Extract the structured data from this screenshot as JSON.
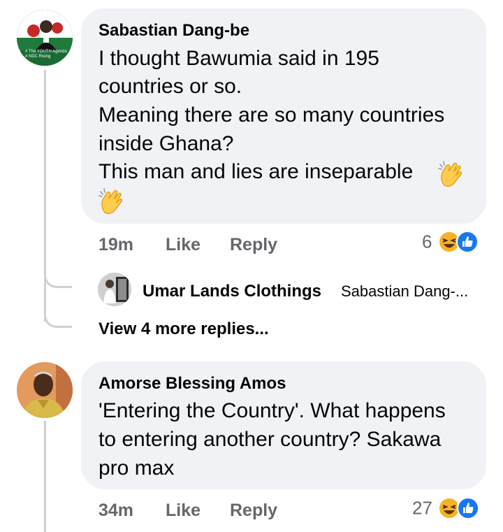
{
  "comments": [
    {
      "author": "Sabastian Dang-be",
      "lines": [
        "I thought Bawumia said in 195",
        "countries or so.",
        "Meaning there are so many countries",
        "inside Ghana?",
        "This man and lies are inseparable"
      ],
      "emoji": "clapping-hands",
      "avatar": {
        "icon": "ndc-profile-photo",
        "caption_lines": [
          "# The YOUTH Agenda",
          "# NDC Rising"
        ]
      },
      "time": "19m",
      "like_label": "Like",
      "reply_label": "Reply",
      "reaction_count": "6",
      "reactions": [
        "haha",
        "like"
      ]
    },
    {
      "author": "Amorse Blessing Amos",
      "lines": [
        "'Entering the Country'.  What happens",
        "to entering another country? Sakawa",
        "pro max"
      ],
      "avatar": {
        "icon": "man-profile-photo"
      },
      "time": "34m",
      "like_label": "Like",
      "reply_label": "Reply",
      "reaction_count": "27",
      "reactions": [
        "haha",
        "like"
      ]
    }
  ],
  "reply_preview": {
    "author": "Umar Lands Clothings",
    "snippet": "Sabastian Dang-...",
    "avatar": {
      "icon": "shop-profile-photo"
    }
  },
  "more_replies_label": "View 4 more replies...",
  "colors": {
    "bubble": "#f0f2f5",
    "secondary_text": "#65676b",
    "like_blue": "#1877f2",
    "haha_yellow": "#f7b125",
    "ndc_green": "#1f7a3d"
  }
}
